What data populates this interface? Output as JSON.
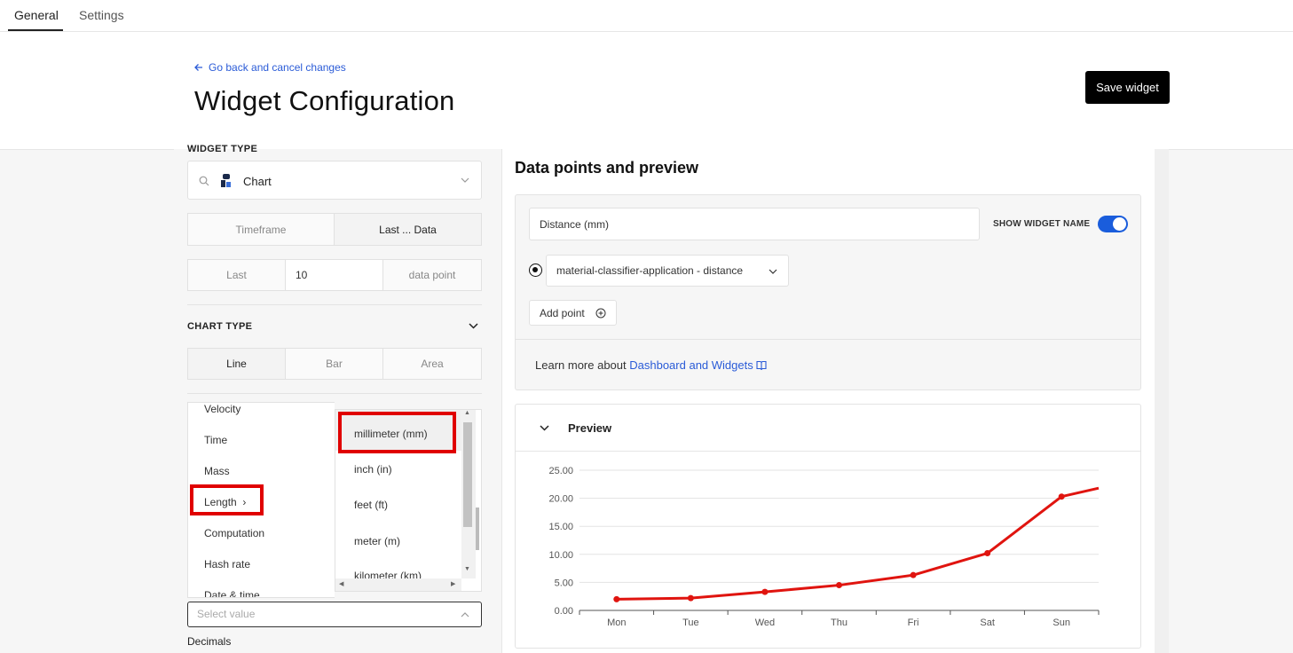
{
  "tabs": [
    {
      "label": "General",
      "active": true
    },
    {
      "label": "Settings",
      "active": false
    }
  ],
  "header": {
    "back_link": "Go back and cancel changes",
    "title": "Widget Configuration",
    "save_label": "Save widget"
  },
  "left": {
    "widget_type_label": "WIDGET TYPE",
    "widget_type_value": "Chart",
    "timeframe_tabs": [
      "Timeframe",
      "Last ... Data"
    ],
    "last_row": {
      "prefix": "Last",
      "value": "10",
      "suffix": "data point"
    },
    "chart_type_label": "CHART TYPE",
    "chart_types": [
      "Line",
      "Bar",
      "Area"
    ],
    "selected_chart_type": "Line",
    "unit_categories": [
      "Velocity",
      "Time",
      "Mass",
      "Length",
      "Computation",
      "Hash rate",
      "Date & time"
    ],
    "selected_category": "Length",
    "units": [
      "millimeter (mm)",
      "inch (in)",
      "feet (ft)",
      "meter (m)",
      "kilometer (km)"
    ],
    "selected_unit": "millimeter (mm)",
    "select_placeholder": "Select value",
    "decimals_label": "Decimals"
  },
  "right": {
    "section_title": "Data points and preview",
    "widget_name": "Distance (mm)",
    "show_widget_name_label": "SHOW WIDGET NAME",
    "show_widget_name": true,
    "data_point": "material-classifier-application - distance",
    "add_point_label": "Add point",
    "learn_more_text": "Learn more about",
    "learn_more_link": "Dashboard and Widgets",
    "preview_label": "Preview"
  },
  "colors": {
    "accent": "#1a5ddc",
    "series": "#e0140f",
    "highlight": "#e00000",
    "link": "#2a5bd7"
  },
  "chart_data": {
    "type": "line",
    "categories": [
      "Mon",
      "Tue",
      "Wed",
      "Thu",
      "Fri",
      "Sat",
      "Sun"
    ],
    "series": [
      {
        "values": [
          2.0,
          2.2,
          3.3,
          4.5,
          6.3,
          10.2,
          20.3,
          21.8
        ]
      }
    ],
    "y_ticks": [
      "25.00",
      "20.00",
      "15.00",
      "10.00",
      "5.00",
      "0.00"
    ],
    "ylim": [
      0,
      25
    ],
    "grid": true
  }
}
